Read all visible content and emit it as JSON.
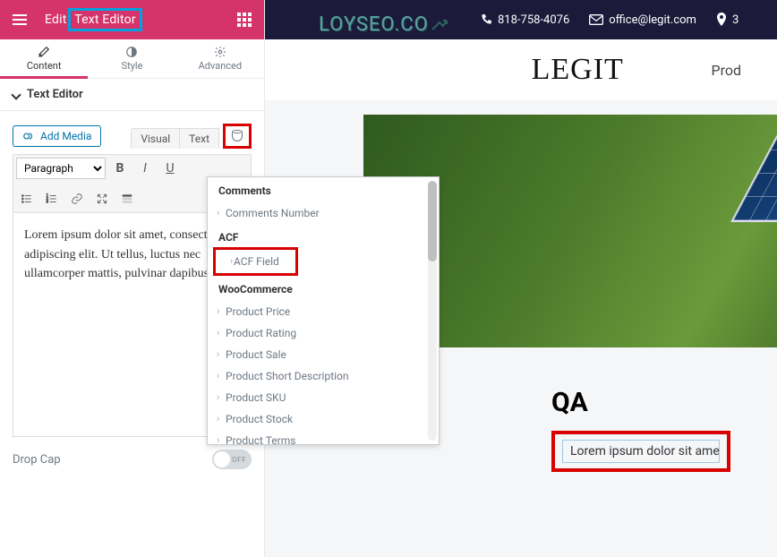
{
  "header": {
    "title_prefix": "Edit",
    "title_main": "Text Editor"
  },
  "watermark": "LOYSEO.CO",
  "tabs": {
    "content": "Content",
    "style": "Style",
    "advanced": "Advanced"
  },
  "section": {
    "title": "Text Editor"
  },
  "editor": {
    "add_media": "Add Media",
    "mode_visual": "Visual",
    "mode_text": "Text",
    "format_select": "Paragraph",
    "body_text": "Lorem ipsum dolor sit amet, consectetur adipiscing elit. Ut tellus, luctus nec ullamcorper mattis, pulvinar dapibus leo."
  },
  "dynamic": {
    "cat1": "Comments",
    "cat1_items": [
      "Comments Number"
    ],
    "cat2": "ACF",
    "cat2_items": [
      "ACF Field"
    ],
    "cat3": "WooCommerce",
    "cat3_items": [
      "Product Price",
      "Product Rating",
      "Product Sale",
      "Product Short Description",
      "Product SKU",
      "Product Stock",
      "Product Terms"
    ]
  },
  "dropcap": {
    "label": "Drop Cap",
    "state": "OFF"
  },
  "preview": {
    "phone": "818-758-4076",
    "email": "office@legit.com",
    "address_num": "3",
    "brand": "LEGIT",
    "nav": "Prod",
    "qa_heading": "QA",
    "qa_text": "Lorem ipsum dolor sit amet, consect"
  }
}
